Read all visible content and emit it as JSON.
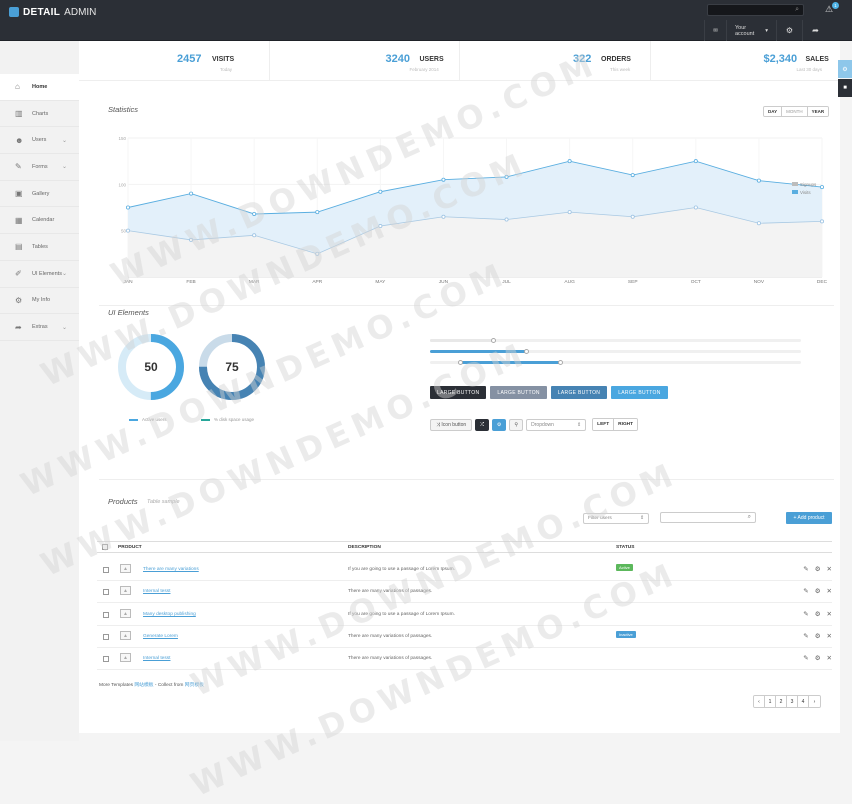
{
  "app": {
    "brand_bold": "DETAIL",
    "brand_rest": "ADMIN"
  },
  "topbar": {
    "account_label": "Your account",
    "notification_count": "1"
  },
  "sidebar": {
    "items": [
      {
        "label": "Home",
        "icon": "home-icon",
        "glyph": "⌂",
        "has_submenu": false
      },
      {
        "label": "Charts",
        "icon": "chart-icon",
        "glyph": "▥",
        "has_submenu": false
      },
      {
        "label": "Users",
        "icon": "users-icon",
        "glyph": "☻",
        "has_submenu": true
      },
      {
        "label": "Forms",
        "icon": "forms-icon",
        "glyph": "✎",
        "has_submenu": true
      },
      {
        "label": "Gallery",
        "icon": "gallery-icon",
        "glyph": "▣",
        "has_submenu": false
      },
      {
        "label": "Calendar",
        "icon": "calendar-icon",
        "glyph": "▦",
        "has_submenu": false
      },
      {
        "label": "Tables",
        "icon": "tables-icon",
        "glyph": "▤",
        "has_submenu": false
      },
      {
        "label": "UI Elements",
        "icon": "ui-elements-icon",
        "glyph": "✐",
        "has_submenu": true
      },
      {
        "label": "My Info",
        "icon": "gear-icon",
        "glyph": "⚙",
        "has_submenu": false
      },
      {
        "label": "Extras",
        "icon": "share-icon",
        "glyph": "➦",
        "has_submenu": true
      }
    ]
  },
  "stats": [
    {
      "value": "2457",
      "label": "VISITS",
      "sub": "Today"
    },
    {
      "value": "3240",
      "label": "USERS",
      "sub": "February 2014"
    },
    {
      "value": "322",
      "label": "ORDERS",
      "sub": "This week"
    },
    {
      "value": "$2,340",
      "label": "SALES",
      "sub": "Last 30 days"
    }
  ],
  "statistics": {
    "title": "Statistics",
    "ranges": [
      "DAY",
      "MONTH",
      "YEAR"
    ],
    "selected_range": "MONTH"
  },
  "chart_data": {
    "type": "area",
    "title": "Statistics",
    "categories": [
      "JAN",
      "FEB",
      "MAR",
      "APR",
      "MAY",
      "JUN",
      "JUL",
      "AUG",
      "SEP",
      "OCT",
      "NOV",
      "DEC"
    ],
    "ylim": [
      0,
      150
    ],
    "yticks": [
      "150",
      "100",
      "50"
    ],
    "series": [
      {
        "name": "Signups",
        "color": "#bcbcbc",
        "values": [
          50,
          40,
          45,
          25,
          55,
          65,
          62,
          70,
          65,
          75,
          58,
          60
        ]
      },
      {
        "name": "Visits",
        "color": "#5aaee0",
        "values": [
          75,
          90,
          68,
          70,
          92,
          105,
          108,
          125,
          110,
          125,
          104,
          97
        ]
      }
    ],
    "grid": true,
    "legend_position": "top-right"
  },
  "ui_elements": {
    "title": "UI Elements",
    "donuts": [
      {
        "value": 50,
        "label": "50",
        "color": "#4aa7e0",
        "track": "#d6ebf7"
      },
      {
        "value": 75,
        "label": "75",
        "color": "#4683b3",
        "track": "#c9dbe9"
      }
    ],
    "donut_legends": [
      {
        "label": "Active users",
        "color": "#4aa7e0"
      },
      {
        "label": "% disk space usage",
        "color": "#27a69a"
      }
    ],
    "sliders": [
      {
        "from": 0,
        "to": 0.17
      },
      {
        "from": 0,
        "to": 0.26
      },
      {
        "from": 0.08,
        "to": 0.35
      }
    ],
    "large_buttons": [
      {
        "label": "LARGE BUTTON",
        "color": "#2b2f36"
      },
      {
        "label": "LARGE BUTTON",
        "color": "#8591a3"
      },
      {
        "label": "LARGE BUTTON",
        "color": "#4683b3"
      },
      {
        "label": "LARGE BUTTON",
        "color": "#4aa7e0"
      }
    ],
    "icon_button_label": "Icon button",
    "dropdown_value": "Dropdown",
    "left_label": "LEFT",
    "right_label": "RIGHT"
  },
  "products": {
    "title": "Products",
    "subtitle": "Table sample",
    "filter_placeholder": "Filter users",
    "add_label": "+ Add product",
    "columns": [
      "PRODUCT",
      "DESCRIPTION",
      "STATUS"
    ],
    "rows": [
      {
        "name": "There are many variations",
        "desc": "If you are going to use a passage of Lorem Ipsum.",
        "status": "Active",
        "status_color": "#5cb85c"
      },
      {
        "name": "Internal tesst",
        "desc": "There are many variations of passages.",
        "status": "",
        "status_color": ""
      },
      {
        "name": "Many desktop publishing",
        "desc": "If you are going to use a passage of Lorem Ipsum.",
        "status": "",
        "status_color": ""
      },
      {
        "name": "Generate Lorem",
        "desc": "There are many variations of passages.",
        "status": "Inactive",
        "status_color": "#4a9fd6"
      },
      {
        "name": "Internal tesst",
        "desc": "There are many variations of passages.",
        "status": "",
        "status_color": ""
      }
    ],
    "pages": [
      "‹",
      "1",
      "2",
      "3",
      "4",
      "›"
    ]
  },
  "footer": {
    "text1": "More Templates ",
    "link1": "网站模板",
    "text2": " - Collect from ",
    "link2": "网页模板"
  },
  "watermark": "WWW.DOWNDEMO.COM"
}
